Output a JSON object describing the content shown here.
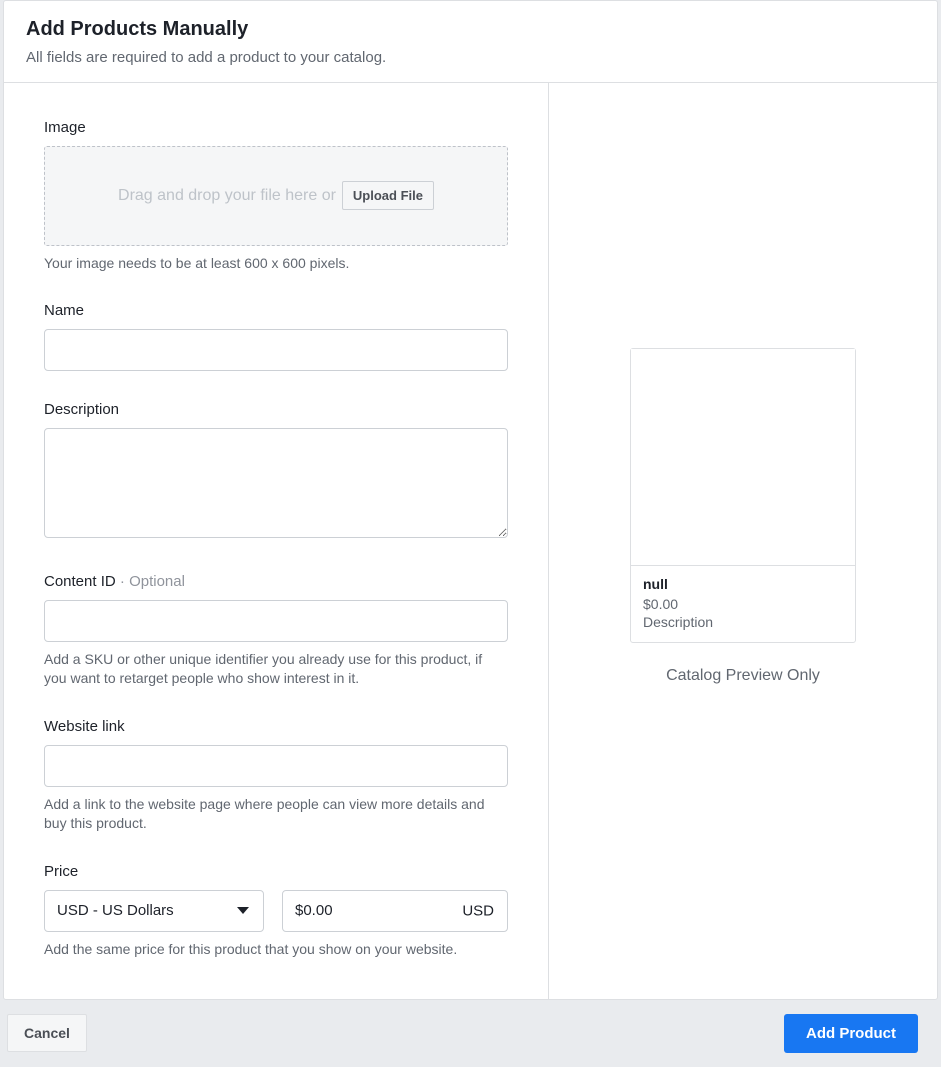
{
  "header": {
    "title": "Add Products Manually",
    "subtitle": "All fields are required to add a product to your catalog."
  },
  "image": {
    "label": "Image",
    "dropzone_text": "Drag and drop your file here or",
    "upload_button": "Upload File",
    "help": "Your image needs to be at least 600 x 600 pixels."
  },
  "name": {
    "label": "Name",
    "value": ""
  },
  "description": {
    "label": "Description",
    "value": ""
  },
  "content_id": {
    "label": "Content ID",
    "optional_marker": "Optional",
    "dot": "·",
    "value": "",
    "help": "Add a SKU or other unique identifier you already use for this product, if you want to retarget people who show interest in it."
  },
  "website": {
    "label": "Website link",
    "value": "",
    "help": "Add a link to the website page where people can view more details and buy this product."
  },
  "price": {
    "label": "Price",
    "currency_selected": "USD - US Dollars",
    "amount": "$0.00",
    "currency_suffix": "USD",
    "help": "Add the same price for this product that you show on your website."
  },
  "preview": {
    "title": "null",
    "price": "$0.00",
    "description": "Description",
    "caption": "Catalog Preview Only"
  },
  "footer": {
    "cancel": "Cancel",
    "add_product": "Add Product"
  }
}
